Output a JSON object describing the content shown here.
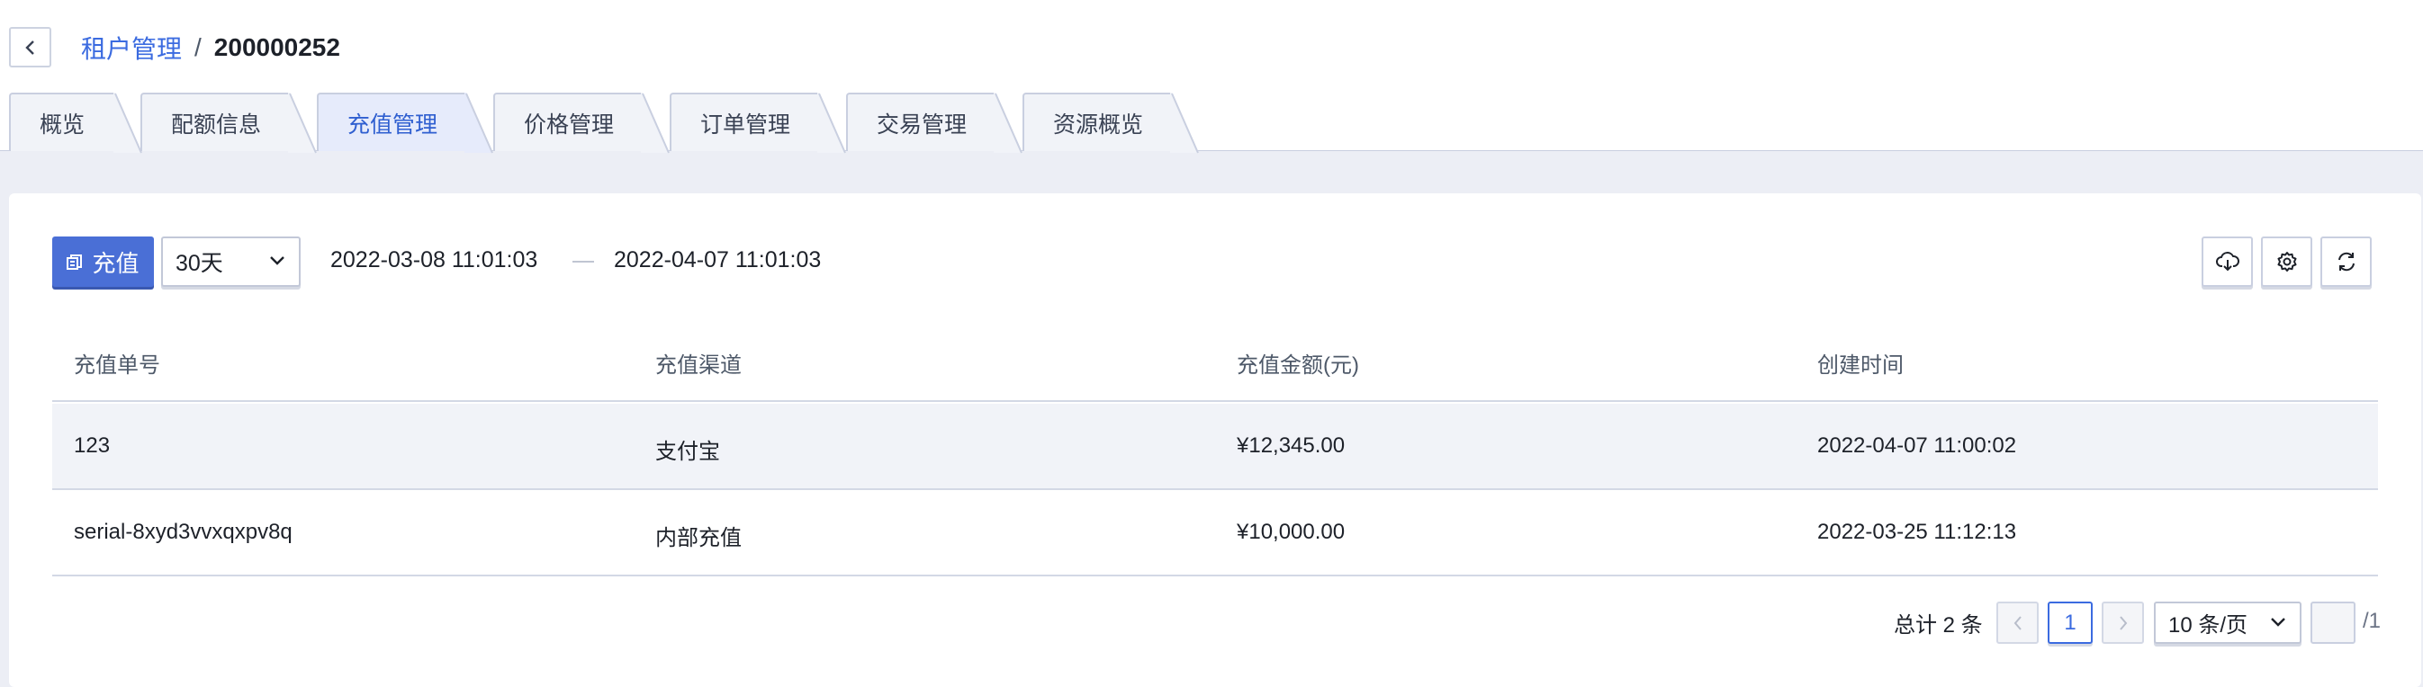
{
  "breadcrumb": {
    "parent": "租户管理",
    "separator": "/",
    "current": "200000252"
  },
  "tabs": [
    {
      "label": "概览",
      "active": false
    },
    {
      "label": "配额信息",
      "active": false
    },
    {
      "label": "充值管理",
      "active": true
    },
    {
      "label": "价格管理",
      "active": false
    },
    {
      "label": "订单管理",
      "active": false
    },
    {
      "label": "交易管理",
      "active": false
    },
    {
      "label": "资源概览",
      "active": false
    }
  ],
  "toolbar": {
    "recharge_label": "充值",
    "range_select": "30天",
    "date_start": "2022-03-08 11:01:03",
    "date_end": "2022-04-07 11:01:03",
    "icons": [
      "cloud-download-icon",
      "gear-icon",
      "refresh-icon"
    ]
  },
  "table": {
    "columns": [
      "充值单号",
      "充值渠道",
      "充值金额(元)",
      "创建时间"
    ],
    "rows": [
      [
        "123",
        "支付宝",
        "¥12,345.00",
        "2022-04-07 11:00:02"
      ],
      [
        "serial-8xyd3vvxqxpv8q",
        "内部充值",
        "¥10,000.00",
        "2022-03-25 11:12:13"
      ]
    ]
  },
  "pagination": {
    "total_label": "总计 2 条",
    "current_page": "1",
    "page_size": "10 条/页",
    "goto_value": "",
    "total_pages": "/1"
  },
  "colors": {
    "primary": "#4a6fd6",
    "link": "#3b6be0",
    "background": "#eceef5"
  }
}
